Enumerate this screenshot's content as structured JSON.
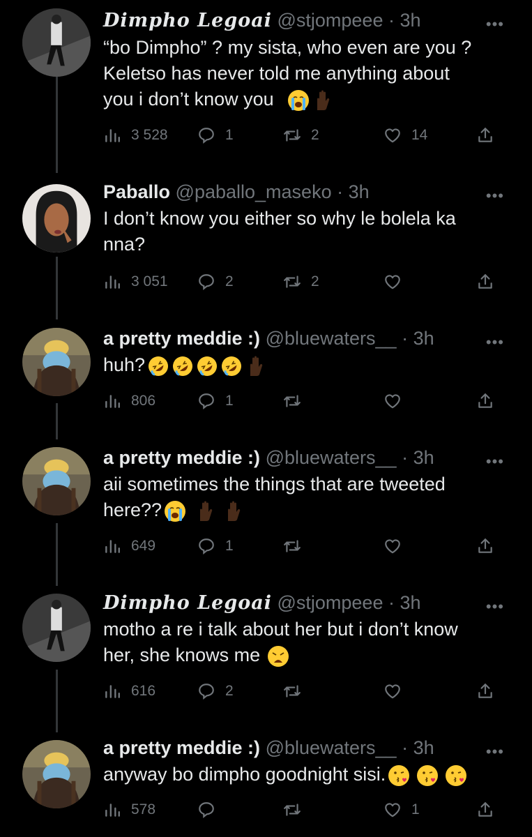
{
  "tweets": [
    {
      "name": "Dimpho Legoai",
      "script": true,
      "handle": "@stjompeee",
      "time": "· 3h",
      "lines": [
        "“bo Dimpho” ? my sista, who even are you ?",
        "Keletso has never told me anything about",
        "you i don’t know you"
      ],
      "emojis": [
        "crying-emoji",
        "raised-hand-emoji"
      ],
      "views": "3 528",
      "replies": "1",
      "retweets": "2",
      "likes": "14"
    },
    {
      "name": "Paballo",
      "script": false,
      "handle": "@paballo_maseko",
      "time": "· 3h",
      "lines": [
        "I don’t know you either so why le bolela ka",
        "nna?"
      ],
      "emojis": [],
      "views": "3 051",
      "replies": "2",
      "retweets": "2",
      "likes": ""
    },
    {
      "name": "a pretty meddie :)",
      "script": false,
      "handle": "@bluewaters__",
      "time": "· 3h",
      "lines": [
        "huh?"
      ],
      "emojis": [
        "rofl-emoji",
        "rofl-emoji",
        "rofl-emoji",
        "rofl-emoji",
        "raised-hand-emoji"
      ],
      "views": "806",
      "replies": "1",
      "retweets": "",
      "likes": ""
    },
    {
      "name": "a pretty meddie :)",
      "script": false,
      "handle": "@bluewaters__",
      "time": "· 3h",
      "lines": [
        "aii sometimes the things that are tweeted",
        "here??"
      ],
      "emojis": [
        "crying-emoji",
        "raised-hand-emoji",
        "raised-hand-emoji"
      ],
      "views": "649",
      "replies": "1",
      "retweets": "",
      "likes": ""
    },
    {
      "name": "Dimpho Legoai",
      "script": true,
      "handle": "@stjompeee",
      "time": "· 3h",
      "lines": [
        "motho a re i talk about her but i don’t know",
        "her, she knows me"
      ],
      "emojis": [
        "weary-emoji"
      ],
      "views": "616",
      "replies": "2",
      "retweets": "",
      "likes": ""
    },
    {
      "name": "a pretty meddie :)",
      "script": false,
      "handle": "@bluewaters__",
      "time": "· 3h",
      "lines": [
        "anyway bo dimpho goodnight sisi."
      ],
      "emojis": [
        "kiss-emoji",
        "kiss-emoji",
        "kiss-emoji"
      ],
      "views": "578",
      "replies": "",
      "retweets": "",
      "likes": "1"
    }
  ],
  "colors": {
    "background": "#000000",
    "text": "#e7e9ea",
    "muted": "#71767b",
    "thread": "#333639"
  }
}
